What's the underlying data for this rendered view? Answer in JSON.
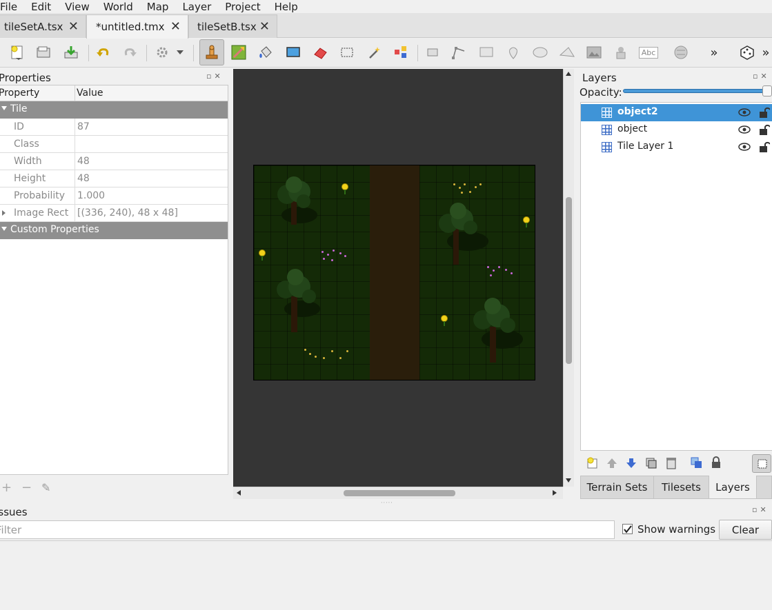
{
  "menu": [
    "File",
    "Edit",
    "View",
    "World",
    "Map",
    "Layer",
    "Project",
    "Help"
  ],
  "tabs": [
    {
      "label": "tileSetA.tsx",
      "close": "✕"
    },
    {
      "label": "*untitled.tmx",
      "close": "✕"
    },
    {
      "label": "tileSetB.tsx",
      "close": "✕"
    }
  ],
  "toolbar": {
    "more": "»",
    "text_tool_label": "Abc",
    "icons": [
      "new-map-icon",
      "open-icon",
      "save-icon",
      "undo-icon",
      "redo-icon",
      "commands-icon",
      "stamp-brush-icon",
      "terrain-brush-icon",
      "bucket-fill-icon",
      "shape-fill-icon",
      "eraser-icon",
      "rect-select-icon",
      "magic-wand-icon",
      "select-same-tile-icon",
      "select-objects-icon",
      "edit-polygons-icon",
      "insert-rectangle-icon",
      "insert-point-icon",
      "insert-ellipse-icon",
      "insert-polygon-icon",
      "insert-tile-icon",
      "insert-template-icon",
      "insert-text-icon",
      "world-tool-icon",
      "random-mode-icon"
    ]
  },
  "properties": {
    "title": "Properties",
    "col_property": "Property",
    "col_value": "Value",
    "group_tile": "Tile",
    "rows": [
      {
        "key": "ID",
        "value": "87"
      },
      {
        "key": "Class",
        "value": ""
      },
      {
        "key": "Width",
        "value": "48"
      },
      {
        "key": "Height",
        "value": "48"
      },
      {
        "key": "Probability",
        "value": "1.000"
      },
      {
        "key": "Image Rect",
        "value": "[(336, 240), 48 x 48]"
      }
    ],
    "group_custom": "Custom Properties",
    "footer": {
      "add": "+",
      "remove": "−",
      "edit": "✎"
    }
  },
  "layers": {
    "title": "Layers",
    "opacity_label": "Opacity:",
    "opacity": 1.0,
    "items": [
      {
        "name": "object2",
        "selected": true
      },
      {
        "name": "object",
        "selected": false
      },
      {
        "name": "Tile Layer 1",
        "selected": false
      }
    ]
  },
  "dock_tabs": [
    "Terrain Sets",
    "Tilesets",
    "Layers"
  ],
  "issues": {
    "title": "Issues",
    "filter_placeholder": "Filter",
    "show_warnings_label": "Show warnings",
    "show_warnings_checked": true,
    "clear_label": "Clear"
  },
  "colors": {
    "accent": "#3f94d7",
    "grass": "#142a07",
    "path": "#2a1e0b"
  }
}
